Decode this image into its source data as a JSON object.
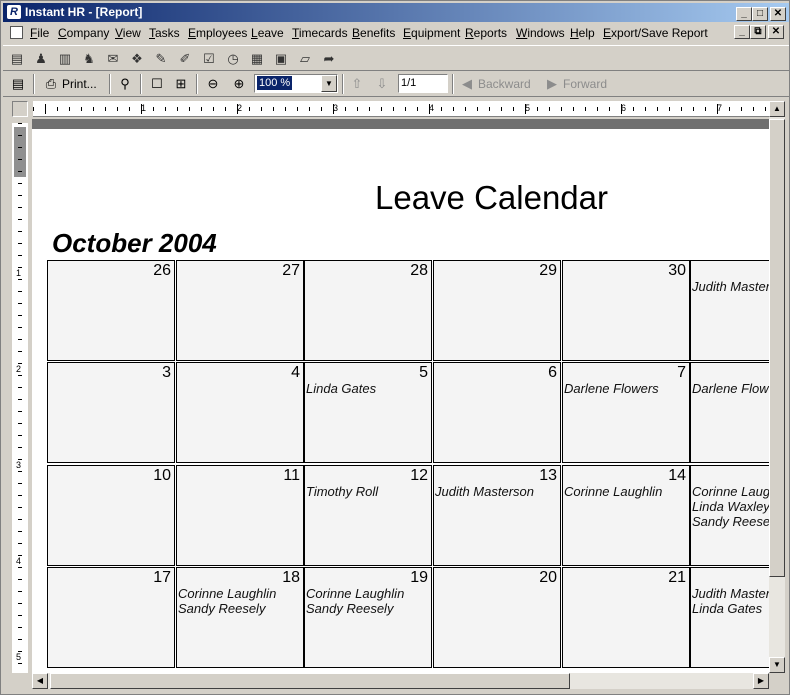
{
  "window": {
    "title": "Instant HR - [Report]",
    "app_icon": "R",
    "controls": [
      "_",
      "□",
      "✕"
    ],
    "mdi_controls": [
      "_",
      "⧉",
      "✕"
    ]
  },
  "menu": [
    "File",
    "Company",
    "View",
    "Tasks",
    "Employees",
    "Leave",
    "Timecards",
    "Benefits",
    "Equipment",
    "Reports",
    "Windows",
    "Help",
    "Export/Save Report"
  ],
  "toolbar_icons": [
    "org-chart-icon",
    "employees-icon",
    "company-icon",
    "group-icon",
    "leave-icon",
    "benefits-icon",
    "equipment-icon",
    "review-icon",
    "clock-icon",
    "timecard-icon",
    "report-icon",
    "folder-open-icon",
    "export-icon"
  ],
  "report_toolbar": {
    "print_label": "Print...",
    "zoom_value": "100 %",
    "page_value": "1/1",
    "backward_label": "Backward",
    "forward_label": "Forward"
  },
  "ruler": {
    "h_labels": [
      "1",
      "2",
      "3",
      "4",
      "5",
      "6",
      "7"
    ],
    "v_labels": [
      "1",
      "2",
      "3",
      "4",
      "5"
    ]
  },
  "report": {
    "title": "Leave Calendar",
    "month": "October 2004",
    "weeks": [
      [
        {
          "day": "26",
          "names": []
        },
        {
          "day": "27",
          "names": []
        },
        {
          "day": "28",
          "names": []
        },
        {
          "day": "29",
          "names": []
        },
        {
          "day": "30",
          "names": []
        },
        {
          "day": "",
          "names": [
            "Judith Masterson"
          ]
        }
      ],
      [
        {
          "day": "3",
          "names": []
        },
        {
          "day": "4",
          "names": []
        },
        {
          "day": "5",
          "names": [
            "Linda Gates"
          ]
        },
        {
          "day": "6",
          "names": []
        },
        {
          "day": "7",
          "names": [
            "Darlene Flowers"
          ]
        },
        {
          "day": "",
          "names": [
            "Darlene Flowers"
          ]
        }
      ],
      [
        {
          "day": "10",
          "names": []
        },
        {
          "day": "11",
          "names": []
        },
        {
          "day": "12",
          "names": [
            "Timothy Roll"
          ]
        },
        {
          "day": "13",
          "names": [
            "Judith Masterson"
          ]
        },
        {
          "day": "14",
          "names": [
            "Corinne Laughlin"
          ]
        },
        {
          "day": "",
          "names": [
            "Corinne Laughlin",
            "Linda Waxley",
            "Sandy Reesely"
          ]
        }
      ],
      [
        {
          "day": "17",
          "names": []
        },
        {
          "day": "18",
          "names": [
            "Corinne Laughlin",
            "Sandy Reesely"
          ]
        },
        {
          "day": "19",
          "names": [
            "Corinne Laughlin",
            "Sandy Reesely"
          ]
        },
        {
          "day": "20",
          "names": []
        },
        {
          "day": "21",
          "names": []
        },
        {
          "day": "",
          "names": [
            "Judith Masterson",
            "Linda Gates"
          ]
        }
      ]
    ]
  }
}
